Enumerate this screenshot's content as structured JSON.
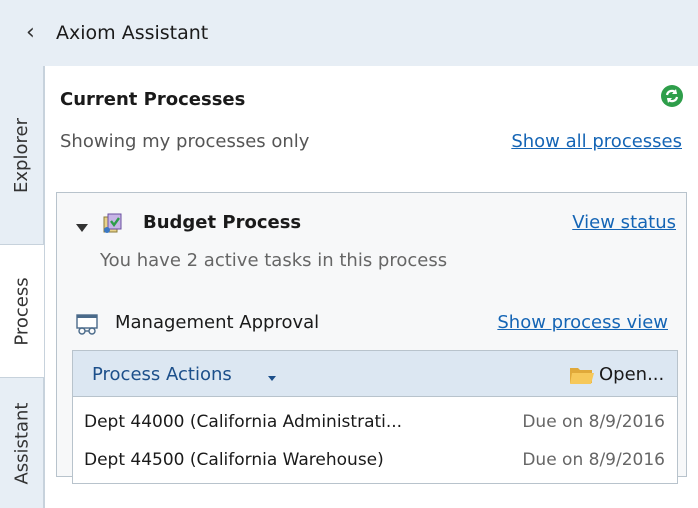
{
  "header": {
    "collapse_glyph": "‹",
    "title": "Axiom Assistant"
  },
  "tabs": [
    {
      "label": "Explorer",
      "active": false
    },
    {
      "label": "Process",
      "active": true
    },
    {
      "label": "Assistant",
      "active": false
    }
  ],
  "current_processes": {
    "title": "Current Processes",
    "filter_text": "Showing my processes only",
    "show_all_link": "Show all processes",
    "refresh_icon": "refresh-icon"
  },
  "process": {
    "name": "Budget Process",
    "view_status_link": "View status",
    "active_tasks_text": "You have 2 active tasks in this process",
    "step": {
      "name": "Management Approval",
      "show_process_view_link": "Show process view"
    },
    "actions_menu_label": "Process Actions",
    "open_button_label": "Open...",
    "tasks": [
      {
        "name": "Dept 44000 (California Administrati...",
        "due": "Due on 8/9/2016"
      },
      {
        "name": "Dept 44500 (California Warehouse)",
        "due": "Due on 8/9/2016"
      }
    ]
  },
  "colors": {
    "header_bg": "#e7eef5",
    "link": "#1565b5",
    "table_header_bg": "#dce7f2",
    "refresh_green": "#2e9e4a"
  }
}
